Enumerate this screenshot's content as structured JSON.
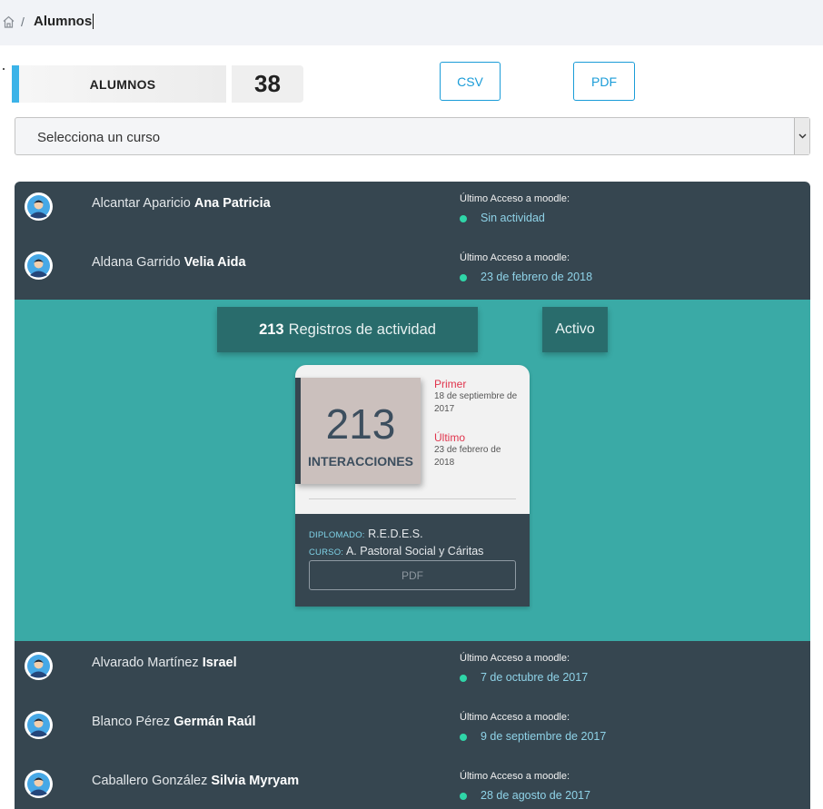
{
  "breadcrumb": {
    "separator": "/",
    "current": "Alumnos"
  },
  "summary": {
    "label": "ALUMNOS",
    "count": "38"
  },
  "buttons": {
    "csv": "CSV",
    "pdf": "PDF"
  },
  "course_select": {
    "selected": "Selecciona un curso"
  },
  "access_label": "Último Acceso a moodle:",
  "students": [
    {
      "last_name": "Alcantar Aparicio",
      "first_name": "Ana Patricia",
      "last_access": "Sin actividad"
    },
    {
      "last_name": "Aldana Garrido",
      "first_name": "Velia Aida",
      "last_access": "23 de febrero de 2018"
    },
    {
      "last_name": "Alvarado Martínez",
      "first_name": "Israel",
      "last_access": "7 de octubre de 2017"
    },
    {
      "last_name": "Blanco Pérez",
      "first_name": "Germán Raúl",
      "last_access": "9 de septiembre de 2017"
    },
    {
      "last_name": "Caballero González",
      "first_name": "Silvia Myryam",
      "last_access": "28 de agosto de 2017"
    }
  ],
  "detail": {
    "records_count": "213",
    "records_label": "Registros de actividad",
    "status": "Activo",
    "card": {
      "interactions_count": "213",
      "interactions_label": "INTERACCIONES",
      "first_label": "Primer",
      "first_date": "18 de septiembre de 2017",
      "last_label": "Último",
      "last_date": "23 de febrero de 2018",
      "diploma_label": "DIPLOMADO:",
      "diploma_value": "R.E.D.E.S.",
      "course_label": "CURSO:",
      "course_value": "A. Pastoral Social y Cáritas",
      "pdf_label": "PDF"
    }
  },
  "colors": {
    "accent": "#1a9cd8",
    "list_bg": "#364650",
    "detail_bg": "#3aaaa6",
    "status_dot": "#2fd6a8",
    "date_head": "#e0344c"
  }
}
